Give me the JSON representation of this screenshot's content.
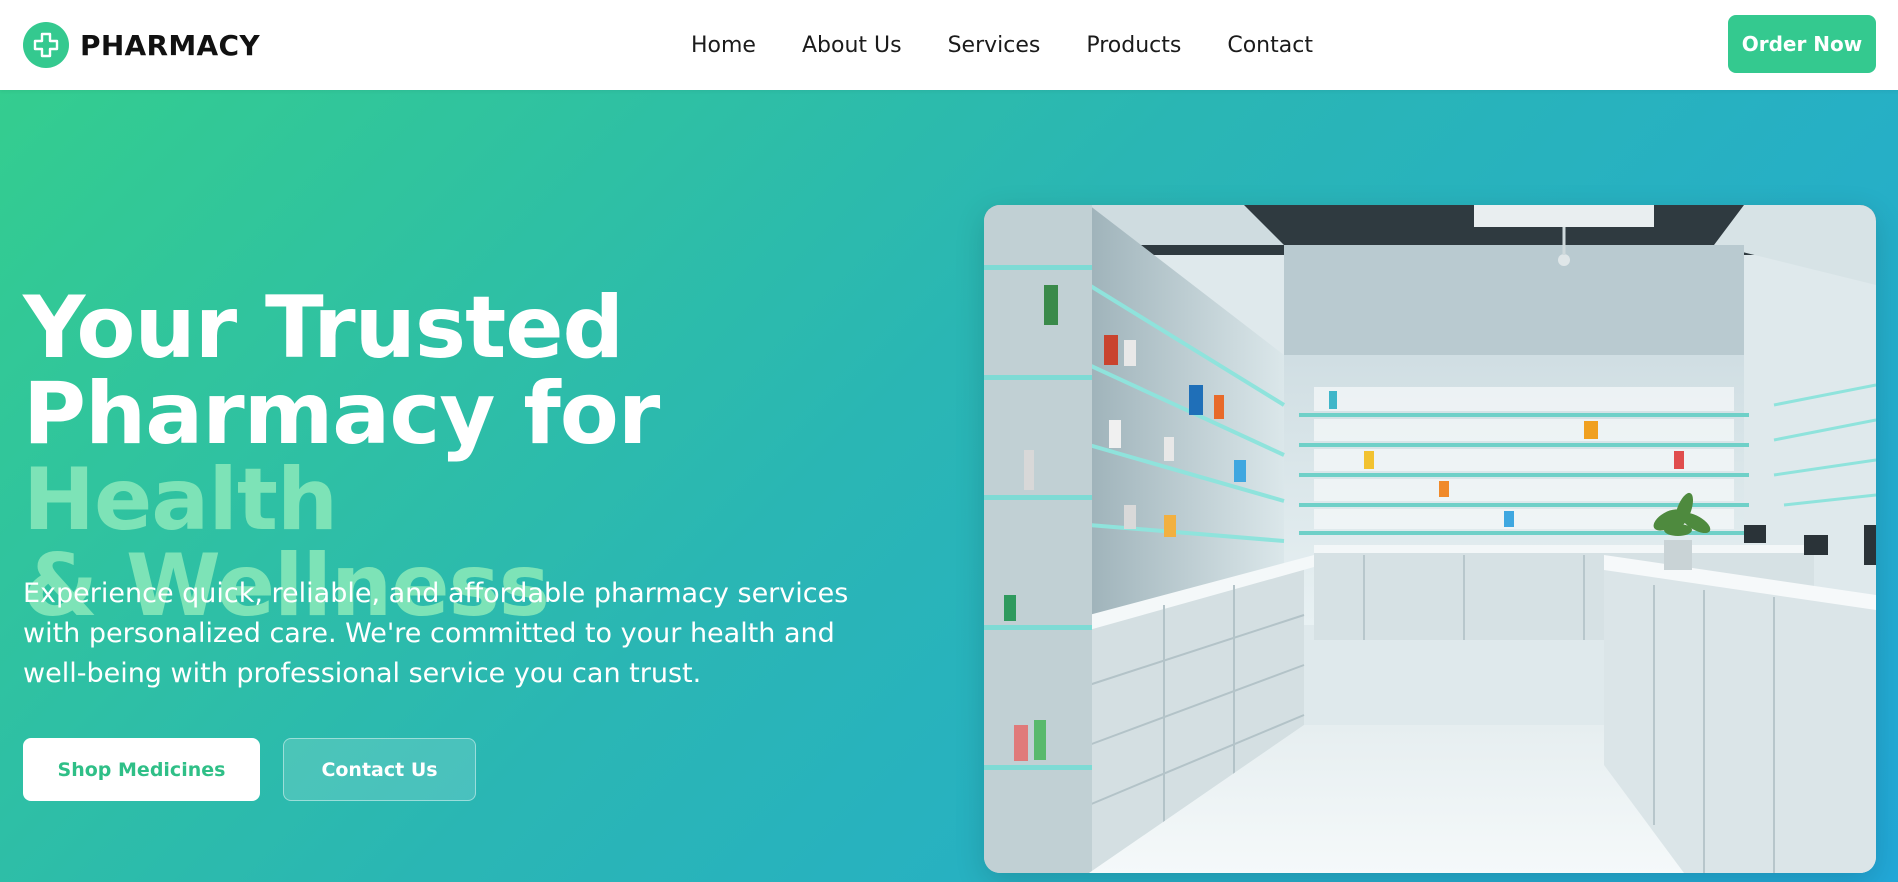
{
  "brand": {
    "name": "PHARMACY",
    "logo_icon": "medical-cross-icon",
    "color": "#34c98f"
  },
  "nav": {
    "items": [
      {
        "label": "Home"
      },
      {
        "label": "About Us"
      },
      {
        "label": "Services"
      },
      {
        "label": "Products"
      },
      {
        "label": "Contact"
      }
    ],
    "cta_label": "Order Now"
  },
  "hero": {
    "title_line1": "Your Trusted",
    "title_line2_plain": "Pharmacy for ",
    "title_line2_accent": "Health",
    "title_line3_accent": "& Wellness",
    "subtitle": "Experience quick, reliable, and affordable pharmacy services with personalized care. We're committed to your health and well-being with professional service you can trust.",
    "primary_button": "Shop Medicines",
    "secondary_button": "Contact Us",
    "image_subject": "pharmacy-interior-photo",
    "colors": {
      "gradient_start": "#34cd8f",
      "gradient_end": "#22a8d8",
      "accent_text": "#7de3b7"
    }
  }
}
